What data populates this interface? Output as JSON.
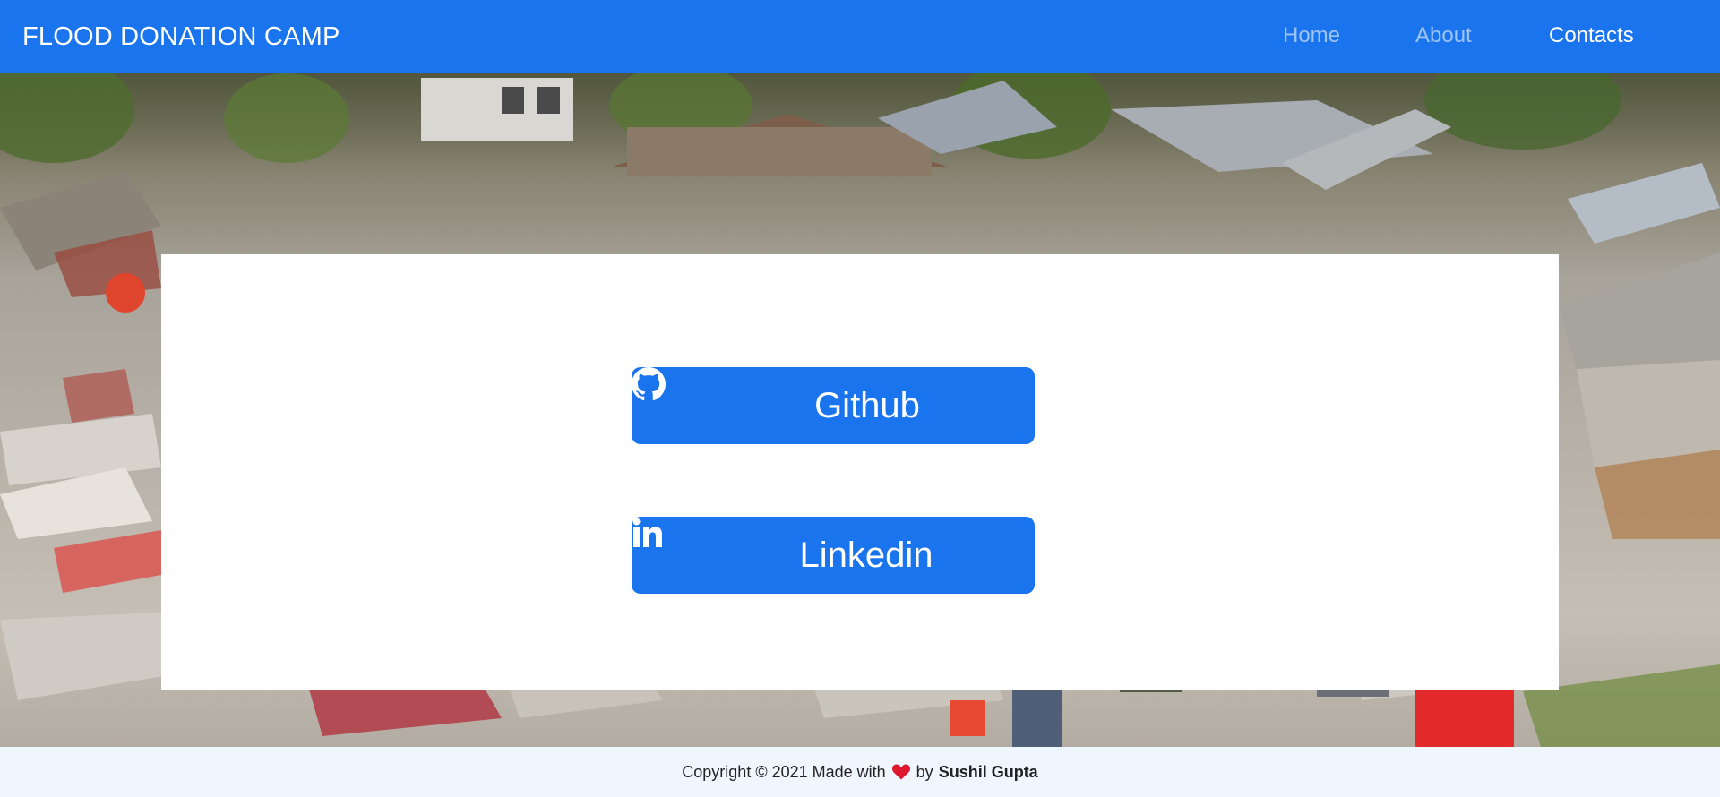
{
  "header": {
    "brand": "FLOOD DONATION CAMP",
    "nav": [
      {
        "label": "Home",
        "active": false
      },
      {
        "label": "About",
        "active": false
      },
      {
        "label": "Contacts",
        "active": true
      }
    ]
  },
  "contacts": {
    "github_label": "Github",
    "github_icon": "github-icon",
    "linkedin_label": "Linkedin",
    "linkedin_icon": "linkedin-icon"
  },
  "footer": {
    "prefix": "Copyright © 2021 Made with",
    "heart_icon": "heart-icon",
    "by": "by",
    "author": "Sushil Gupta"
  },
  "colors": {
    "primary": "#1a74ed",
    "nav_inactive": "#9ec3f5",
    "footer_bg": "#f0f6fd",
    "heart": "#e0182d"
  }
}
